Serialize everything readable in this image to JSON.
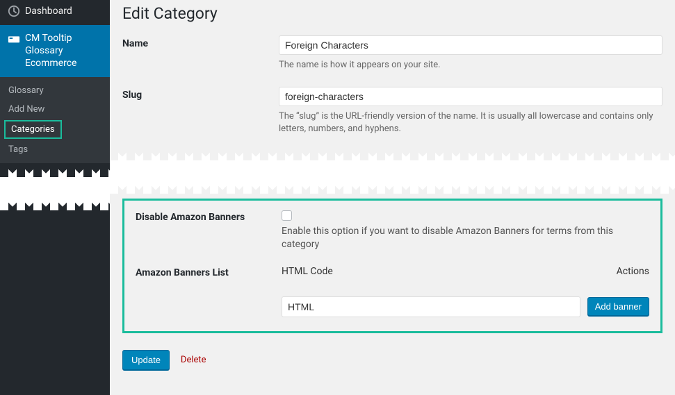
{
  "sidebar": {
    "dashboard": "Dashboard",
    "activePlugin": "CM Tooltip Glossary Ecommerce",
    "submenu": {
      "glossary": "Glossary",
      "addNew": "Add New",
      "categories": "Categories",
      "tags": "Tags"
    }
  },
  "page": {
    "title": "Edit Category"
  },
  "form": {
    "nameLabel": "Name",
    "nameValue": "Foreign Characters",
    "nameDesc": "The name is how it appears on your site.",
    "slugLabel": "Slug",
    "slugValue": "foreign-characters",
    "slugDesc": "The “slug” is the URL-friendly version of the name. It is usually all lowercase and contains only letters, numbers, and hyphens."
  },
  "amazon": {
    "disableLabel": "Disable Amazon Banners",
    "disableDesc": "Enable this option if you want to disable Amazon Banners for terms from this category",
    "listLabel": "Amazon Banners List",
    "colHtml": "HTML Code",
    "colActions": "Actions",
    "inputPlaceholder": "HTML",
    "addBtn": "Add banner"
  },
  "actions": {
    "update": "Update",
    "delete": "Delete"
  }
}
